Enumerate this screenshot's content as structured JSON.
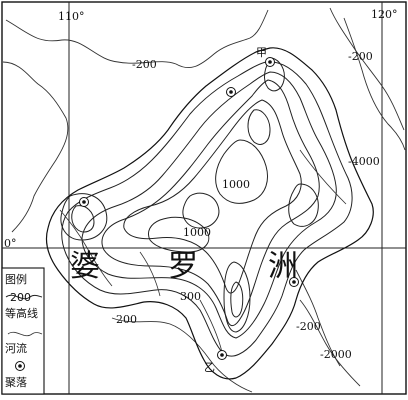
{
  "map": {
    "coordinates": {
      "lon_110": "110°",
      "lon_120": "120°",
      "lat_0": "0°"
    },
    "region_name": [
      "婆",
      "罗",
      "洲"
    ],
    "contour_labels": {
      "sea_nw": "-200",
      "sea_ne": "-200",
      "sea_e": "-4000",
      "sea_se": "-200",
      "sea_s": "-2000",
      "land_1000_a": "1000",
      "land_1000_b": "1000",
      "land_300": "300",
      "land_200": "200"
    },
    "settlements": {
      "jia": "甲",
      "yi": "乙"
    }
  },
  "legend": {
    "title": "图例",
    "contour_value": "200",
    "contour_label": "等高线",
    "river_label": "河流",
    "settlement_label": "聚落"
  }
}
